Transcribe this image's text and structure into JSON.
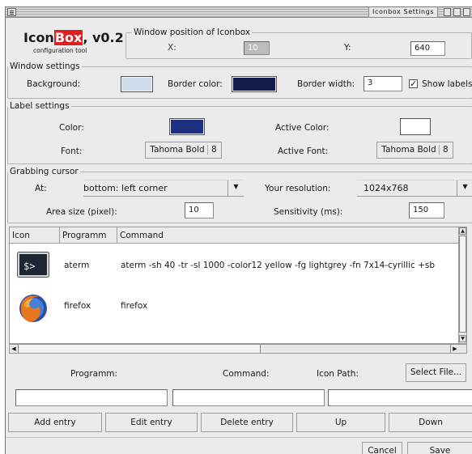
{
  "window": {
    "title": "Iconbox Settings"
  },
  "branding": {
    "name_prefix": "Icon",
    "name_highlight": "Box",
    "version": ", v0.2",
    "subtitle": "configuration tool"
  },
  "position": {
    "legend": "Window position of Iconbox",
    "x_label": "X:",
    "x_value": "10",
    "y_label": "Y:",
    "y_value": "640"
  },
  "window_settings": {
    "legend": "Window settings",
    "background_label": "Background:",
    "background_color": "#cfdbe8",
    "border_color_label": "Border color:",
    "border_color": "#141a4a",
    "border_width_label": "Border width:",
    "border_width_value": "3",
    "show_labels_label": "Show labels",
    "show_labels_checked": true
  },
  "label_settings": {
    "legend": "Label settings",
    "color_label": "Color:",
    "color": "#1e3080",
    "active_color_label": "Active Color:",
    "active_color": "#ffffff",
    "font_label": "Font:",
    "font_value": "Tahoma Bold",
    "font_size": "8",
    "active_font_label": "Active Font:",
    "active_font_value": "Tahoma Bold",
    "active_font_size": "8"
  },
  "grabbing": {
    "legend": "Grabbing cursor",
    "at_label": "At:",
    "at_value": "bottom: left corner",
    "resolution_label": "Your resolution:",
    "resolution_value": "1024x768",
    "area_label": "Area size (pixel):",
    "area_value": "10",
    "sensitivity_label": "Sensitivity (ms):",
    "sensitivity_value": "150"
  },
  "table": {
    "headers": [
      "Icon",
      "Programm",
      "Command"
    ],
    "rows": [
      {
        "icon": "terminal-icon",
        "programm": "aterm",
        "command": "aterm -sh 40 -tr -sl 1000 -color12 yellow -fg lightgrey -fn 7x14-cyrillic +sb"
      },
      {
        "icon": "firefox-icon",
        "programm": "firefox",
        "command": "firefox"
      }
    ]
  },
  "entry": {
    "programm_label": "Programm:",
    "command_label": "Command:",
    "icon_path_label": "Icon Path:",
    "select_file_label": "Select File...",
    "programm_value": "",
    "command_value": "",
    "icon_path_value": ""
  },
  "actions": {
    "add": "Add entry",
    "edit": "Edit entry",
    "delete": "Delete entry",
    "up": "Up",
    "down": "Down"
  },
  "footer": {
    "cancel": "Cancel",
    "save": "Save"
  }
}
